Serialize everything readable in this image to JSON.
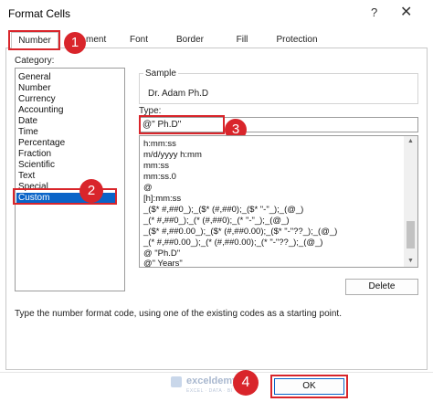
{
  "window": {
    "title": "Format Cells",
    "help_glyph": "?",
    "close_glyph": "✕"
  },
  "tabs": [
    {
      "label": "Number"
    },
    {
      "label": "ment"
    },
    {
      "label": "Font"
    },
    {
      "label": "Border"
    },
    {
      "label": "Fill"
    },
    {
      "label": "Protection"
    }
  ],
  "category": {
    "label": "Category:",
    "items": [
      "General",
      "Number",
      "Currency",
      "Accounting",
      "Date",
      "Time",
      "Percentage",
      "Fraction",
      "Scientific",
      "Text",
      "Special",
      "Custom"
    ],
    "selected": "Custom"
  },
  "sample": {
    "label": "Sample",
    "value": "Dr. Adam Ph.D"
  },
  "type": {
    "label": "Type:",
    "value": "@\" Ph.D\"",
    "list": [
      "h:mm:ss",
      "m/d/yyyy h:mm",
      "mm:ss",
      "mm:ss.0",
      "@",
      "[h]:mm:ss",
      "_($* #,##0_);_($* (#,##0);_($* \"-\"_);_(@_)",
      "_(* #,##0_);_(* (#,##0);_(* \"-\"_);_(@_)",
      "_($* #,##0.00_);_($* (#,##0.00);_($* \"-\"??_);_(@_)",
      "_(* #,##0.00_);_(* (#,##0.00);_(* \"-\"??_);_(@_)",
      "@ \"Ph.D\"",
      "@\" Years\""
    ]
  },
  "buttons": {
    "delete": "Delete",
    "ok": "OK"
  },
  "description": "Type the number format code, using one of the existing codes as a starting point.",
  "badges": [
    "1",
    "2",
    "3",
    "4"
  ],
  "watermark": {
    "name": "exceldemy",
    "sub": "EXCEL · DATA · BI"
  },
  "colors": {
    "accent_red": "#d9252b",
    "selection_blue": "#0a64c8"
  }
}
